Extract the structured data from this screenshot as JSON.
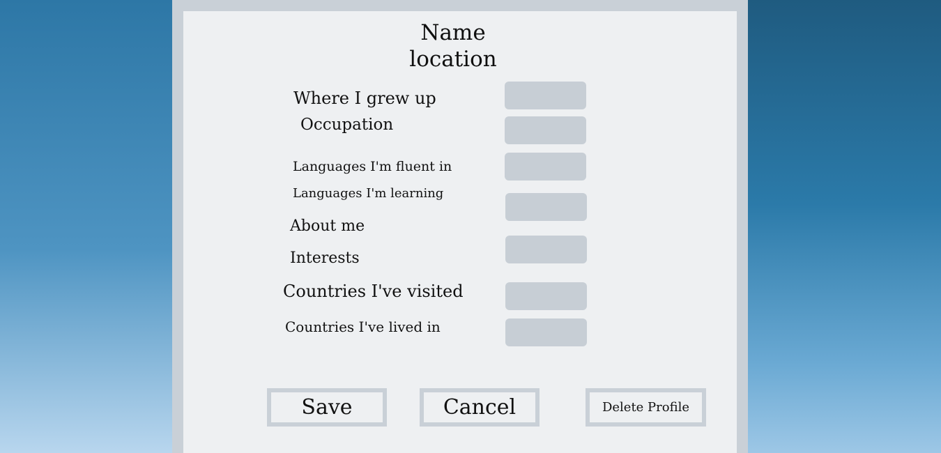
{
  "profile": {
    "name_heading": "Name",
    "location_heading": "location"
  },
  "form": {
    "fields": [
      {
        "label": "Where I grew up",
        "value": ""
      },
      {
        "label": "Occupation",
        "value": ""
      },
      {
        "label": "Languages I'm fluent in",
        "value": ""
      },
      {
        "label": "Languages I'm learning",
        "value": ""
      },
      {
        "label": "About me",
        "value": ""
      },
      {
        "label": "Interests",
        "value": ""
      },
      {
        "label": "Countries I've visited",
        "value": ""
      },
      {
        "label": "Countries I've lived in",
        "value": ""
      }
    ]
  },
  "actions": {
    "save_label": "Save",
    "cancel_label": "Cancel",
    "delete_label": "Delete Profile"
  },
  "colors": {
    "panel": "#eef0f2",
    "frame": "#c9d0d7",
    "input": "#c7ced5",
    "text": "#111111"
  }
}
